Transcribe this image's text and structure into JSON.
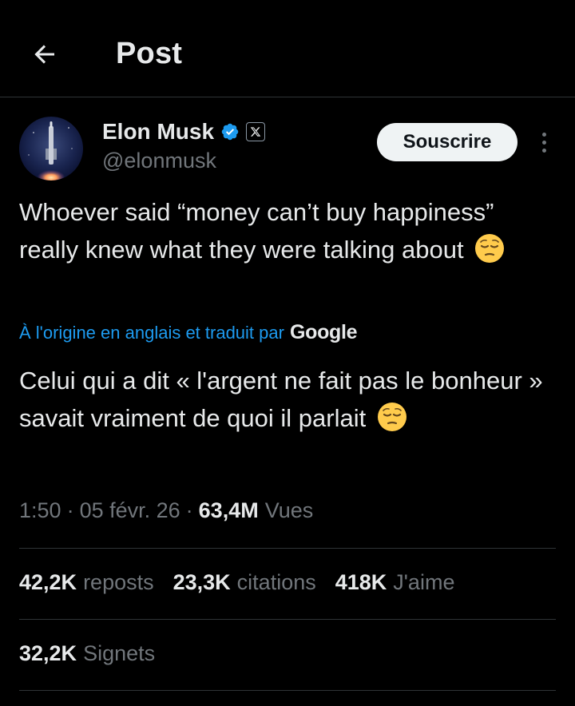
{
  "header": {
    "back_icon": "arrow-left-icon",
    "title": "Post"
  },
  "author": {
    "name": "Elon Musk",
    "handle": "@elonmusk",
    "verified_icon": "verified-badge-icon",
    "affiliate_icon": "x-logo-icon",
    "avatar": "rocket-avatar",
    "subscribe_label": "Souscrire",
    "more_icon": "more-vertical-icon"
  },
  "post": {
    "original_text": "Whoever said “money can’t buy happiness” really knew what they were talking about",
    "translation_note": "À l'origine en anglais et traduit par",
    "translation_provider": "Google",
    "translated_text": "Celui qui a dit « l'argent ne fait pas le bonheur » savait vraiment de quoi il parlait",
    "emoji": "pensive-face-emoji"
  },
  "meta": {
    "time": "1:50",
    "date": "05 févr. 26",
    "views_count": "63,4M",
    "views_label": "Vues",
    "separator": "·"
  },
  "stats": {
    "reposts": {
      "count": "42,2K",
      "label": "reposts"
    },
    "quotes": {
      "count": "23,3K",
      "label": "citations"
    },
    "likes": {
      "count": "418K",
      "label": "J'aime"
    },
    "bookmarks": {
      "count": "32,2K",
      "label": "Signets"
    }
  },
  "colors": {
    "background": "#000000",
    "text_primary": "#e7e9ea",
    "text_secondary": "#71767b",
    "accent_blue": "#1d9bf0",
    "divider": "#2f3336",
    "button_bg": "#eff3f4"
  }
}
